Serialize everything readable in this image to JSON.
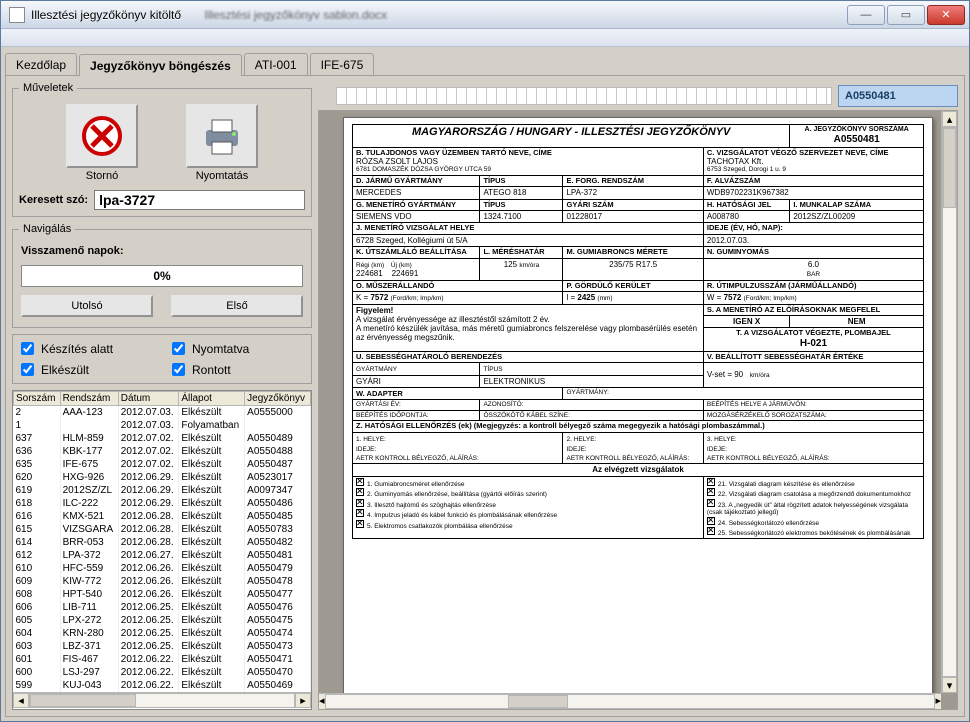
{
  "window": {
    "title": "Illesztési jegyzőkönyv kitöltő",
    "blurred_doc": "Illesztési jegyzőkönyv sablon.docx"
  },
  "tabs": [
    "Kezdőlap",
    "Jegyzőkönyv böngészés",
    "ATI-001",
    "IFE-675"
  ],
  "active_tab": 1,
  "ops_group_title": "Műveletek",
  "op_storno": "Stornó",
  "op_print": "Nyomtatás",
  "search_label": "Keresett szó:",
  "search_value": "lpa-3727",
  "nav_group_title": "Navigálás",
  "nav_days_label": "Visszamenő napok:",
  "progress_text": "0%",
  "btn_last": "Utolsó",
  "btn_first": "Első",
  "filters": {
    "making": "Készítés alatt",
    "printed": "Nyomtatva",
    "done": "Elkészült",
    "broken": "Rontott"
  },
  "grid_headers": [
    "Sorszám",
    "Rendszám",
    "Dátum",
    "Állapot",
    "Jegyzőkönyv"
  ],
  "grid_rows": [
    [
      "2",
      "AAA-123",
      "2012.07.03.",
      "Elkészült",
      "A0555000"
    ],
    [
      "1",
      "",
      "2012.07.03.",
      "Folyamatban",
      ""
    ],
    [
      "637",
      "HLM-859",
      "2012.07.02.",
      "Elkészült",
      "A0550489"
    ],
    [
      "636",
      "KBK-177",
      "2012.07.02.",
      "Elkészült",
      "A0550488"
    ],
    [
      "635",
      "IFE-675",
      "2012.07.02.",
      "Elkészült",
      "A0550487"
    ],
    [
      "620",
      "HXG-926",
      "2012.06.29.",
      "Elkészült",
      "A0523017"
    ],
    [
      "619",
      "2012SZ/ZL",
      "2012.06.29.",
      "Elkészült",
      "A0097347"
    ],
    [
      "618",
      "ILC-222",
      "2012.06.29.",
      "Elkészült",
      "A0550486"
    ],
    [
      "616",
      "KMX-521",
      "2012.06.28.",
      "Elkészült",
      "A0550485"
    ],
    [
      "615",
      "VIZSGARA",
      "2012.06.28.",
      "Elkészült",
      "A0550783"
    ],
    [
      "614",
      "BRR-053",
      "2012.06.28.",
      "Elkészült",
      "A0550482"
    ],
    [
      "612",
      "LPA-372",
      "2012.06.27.",
      "Elkészült",
      "A0550481"
    ],
    [
      "610",
      "HFC-559",
      "2012.06.26.",
      "Elkészült",
      "A0550479"
    ],
    [
      "609",
      "KIW-772",
      "2012.06.26.",
      "Elkészült",
      "A0550478"
    ],
    [
      "608",
      "HPT-540",
      "2012.06.26.",
      "Elkészült",
      "A0550477"
    ],
    [
      "606",
      "LIB-711",
      "2012.06.25.",
      "Elkészült",
      "A0550476"
    ],
    [
      "605",
      "LPX-272",
      "2012.06.25.",
      "Elkészült",
      "A0550475"
    ],
    [
      "604",
      "KRN-280",
      "2012.06.25.",
      "Elkészült",
      "A0550474"
    ],
    [
      "603",
      "LBZ-371",
      "2012.06.25.",
      "Elkészült",
      "A0550473"
    ],
    [
      "601",
      "FIS-467",
      "2012.06.22.",
      "Elkészült",
      "A0550471"
    ],
    [
      "600",
      "LSJ-297",
      "2012.06.22.",
      "Elkészült",
      "A0550470"
    ],
    [
      "599",
      "KUJ-043",
      "2012.06.22.",
      "Elkészült",
      "A0550469"
    ]
  ],
  "doc_id": "A0550481",
  "doc": {
    "main_title": "MAGYARORSZÁG /  HUNGARY - ILLESZTÉSI JEGYZŐKÖNYV",
    "A_label": "A. JEGYZŐKÖNYV SORSZÁMA",
    "A_val": "A0550481",
    "B_label": "B. TULAJDONOS VAGY ÜZEMBEN TARTÓ NEVE, CÍME",
    "B_name": "RÓZSA ZSOLT LAJOS",
    "B_addr": "6781 DOMASZÉK DÓZSA GYÖRGY UTCA 59",
    "C_label": "C. VIZSGÁLATOT VÉGZŐ SZERVEZET NEVE, CÍME",
    "C_name": "TACHOTAX Kft.",
    "C_addr": "6753 Szeged, Dorogi 1 u. 9",
    "D_label": "D. JÁRMŰ GYÁRTMÁNY",
    "D_type": "TÍPUS",
    "D_forg": "E. FORG. RENDSZÁM",
    "D_alv": "F. ALVÁZSZÁM",
    "D_make": "MERCEDES",
    "D_model": "ATEGO 818",
    "D_plate": "LPA-372",
    "D_vin": "WDB9702231K967382",
    "G_label": "G. MENETÍRÓ GYÁRTMÁNY",
    "G_type": "TÍPUS",
    "G_gyari": "GYÁRI SZÁM",
    "G_hatjel": "H. HATÓSÁGI JEL",
    "G_munka": "I. MUNKALAP SZÁMA",
    "G_make": "SIEMENS VDO",
    "G_model": "1324.7100",
    "G_serial": "01228017",
    "G_auth": "A008780",
    "G_work": "2012SZ/ZL00209",
    "J_label": "J. MENETÍRÓ VIZSGÁLAT HELYE",
    "J_time_label": "IDEJE (ÉV, HÓ, NAP):",
    "J_place": "6728 Szeged, Kollégiumi út 5/A",
    "J_date": "2012.07.03.",
    "K_label": "K. ÚTSZÁMLÁLÓ BEÁLLÍTÁSA",
    "K_old": "Régi (km)",
    "K_new": "Új (km)",
    "K_old_v": "224681",
    "K_new_v": "224691",
    "L_label": "L. MÉRÉSHATÁR",
    "L_val": "125",
    "L_unit": "km/óra",
    "M_label": "M. GUMIABRONCS MÉRETE",
    "M_val": "235/75 R17.5",
    "N_label": "N. GUMINYOMÁS",
    "N_val": "6.0",
    "N_unit": "BAR",
    "O_label": "O. MŰSZERÁLLANDÓ",
    "O_k": "K =",
    "O_kv": "7572",
    "O_unit": "(Ford/km; Imp/km)",
    "P_label": "P. GÖRDÜLŐ KERÜLET",
    "P_l": "l =",
    "P_lv": "2425",
    "P_unit": "(mm)",
    "R_label": "R. ÚTIMPULZUSSZÁM (JÁRMŰÁLLANDÓ)",
    "R_w": "W =",
    "R_wv": "7572",
    "R_unit": "(Ford/km; Imp/km)",
    "warn_t": "Figyelem!",
    "warn1": "A vizsgálat érvényessége az illesztéstől számított 2 év.",
    "warn2": "A menetíró készülék javítása, más méretű gumiabroncs felszerelése vagy plombasérülés esetén az érvényesség megszűnik.",
    "S_label": "S. A MENETÍRÓ AZ ELŐÍRÁSOKNAK MEGFELEL",
    "S_yes": "IGEN    X",
    "S_no": "NEM",
    "T_label": "T. A VIZSGÁLATOT VÉGEZTE, PLOMBAJEL",
    "T_val": "H-021",
    "U_label": "U. SEBESSÉGHATÁROLÓ BERENDEZÉS",
    "U_make_l": "GYÁRTMÁNY",
    "U_type_l": "TÍPUS",
    "U_make": "GYÁRI",
    "U_type": "ELEKTRONIKUS",
    "V_label": "V. BEÁLLÍTOTT SEBESSÉGHATÁR ÉRTÉKE",
    "V_val": "V-set = 90",
    "V_unit": "km/óra",
    "W_label": "W. ADAPTER",
    "W_make_l": "GYÁRTMÁNY:",
    "W_year": "GYÁRTÁSI ÉV:",
    "W_id": "AZONOSÍTÓ:",
    "W_place": "BEÉPÍTÉS HELYE A JÁRMŰVÖN:",
    "W_date": "BEÉPÍTÉS IDŐPONTJA:",
    "W_cable": "ÖSSZÖKÖTŐ KÁBEL SZÍNE:",
    "W_sensor": "MOZGÁSÉRZÉKELŐ SOROZATSZÁMA:",
    "Z_label": "Z. HATÓSÁGI ELLENŐRZÉS (ek) (Megjegyzés: a kontroll bélyegző száma megegyezik a hatósági plombaszámmal.)",
    "Z_hely": "1. HELYE:",
    "Z_hely2": "2. HELYE:",
    "Z_hely3": "3. HELYE:",
    "Z_ideje": "IDEJE:",
    "Z_sign": "AETR KONTROLL BÉLYEGZŐ, ALÁÍRÁS:",
    "exams_title": "Az elvégzett vizsgálatok",
    "exams_left": [
      "Gumiabroncsméret ellenőrzése",
      "Guminyomás ellenőrzése, beállítása (gyártói előírás szerint)",
      "Illesztő hajtómű és szöghajtás ellenőrzése",
      "Impulzus jeladó és kábel funkció és plombálásának ellenőrzése",
      "Elektromos csatlakozók plombálása ellenőrzése"
    ],
    "exams_right": [
      "Vizsgálati diagram készítése és ellenőrzése",
      "Vizsgálati diagram csatolása a megőrzendő dokumentumokhoz",
      "A „negyedik út” által rögzített adatok helyességének vizsgálata (csak tájékoztató jellegű)",
      "Sebességkorlátozó ellenőrzése",
      "Sebességkorlátozó elektromos bekötésének és plombálásának"
    ],
    "ex_left_nums": [
      "1.",
      "2.",
      "3.",
      "4.",
      "5."
    ],
    "ex_right_nums": [
      "21.",
      "22.",
      "23.",
      "24.",
      "25."
    ]
  }
}
